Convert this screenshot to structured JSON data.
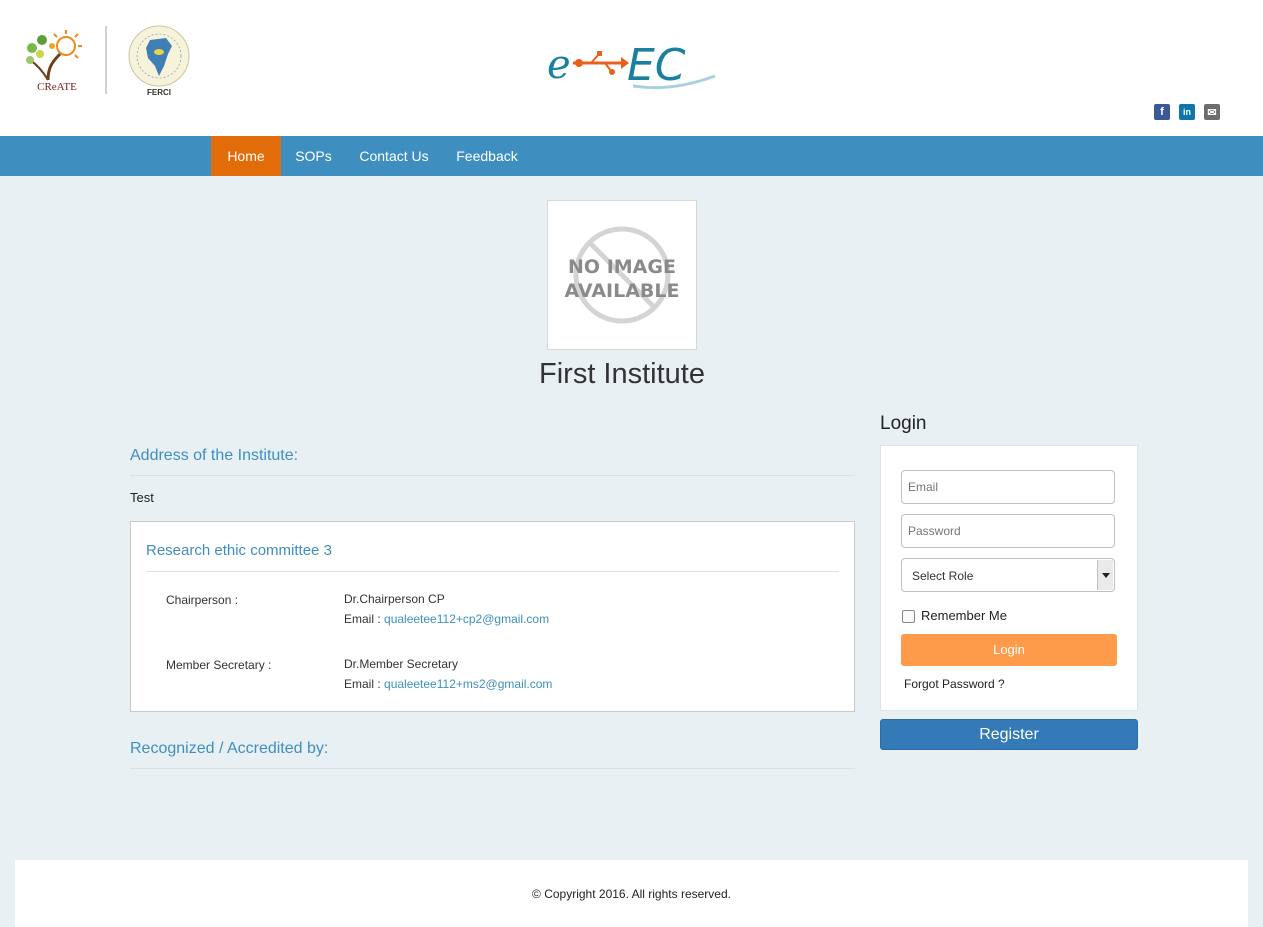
{
  "header": {
    "create_logo_text": "CReATE",
    "ferci_logo_text": "FERCI",
    "eec_logo_text": "e-EC"
  },
  "social": {
    "facebook": "f",
    "linkedin": "in",
    "email": "✉"
  },
  "nav": {
    "items": [
      {
        "label": "Home",
        "active": true
      },
      {
        "label": "SOPs",
        "active": false
      },
      {
        "label": "Contact Us",
        "active": false
      },
      {
        "label": "Feedback",
        "active": false
      }
    ]
  },
  "institute": {
    "image_text_1": "NO IMAGE",
    "image_text_2": "AVAILABLE",
    "name": "First Institute"
  },
  "address": {
    "heading": "Address of the Institute:",
    "text": "Test"
  },
  "committee": {
    "title": "Research ethic committee 3",
    "chairperson_label": "Chairperson :",
    "chairperson_name": "Dr.Chairperson CP",
    "email_prefix": "Email : ",
    "chairperson_email": "qualeetee112+cp2@gmail.com",
    "secretary_label": "Member Secretary :",
    "secretary_name": "Dr.Member Secretary",
    "secretary_email": "qualeetee112+ms2@gmail.com"
  },
  "recognized": {
    "heading": "Recognized / Accredited by:"
  },
  "login": {
    "heading": "Login",
    "email_placeholder": "Email",
    "password_placeholder": "Password",
    "role_selected": "Select Role",
    "remember_label": "Remember Me",
    "login_button": "Login",
    "forgot_label": "Forgot Password ?",
    "register_button": "Register"
  },
  "footer": {
    "copyright": "© Copyright 2016. All rights reserved."
  },
  "colors": {
    "nav_bg": "#3e8fc0",
    "nav_active": "#e36c0a",
    "link": "#3e8fc0",
    "login_btn": "#fd9b4a",
    "register_btn": "#337ab7",
    "page_bg": "#e9f0f4"
  }
}
